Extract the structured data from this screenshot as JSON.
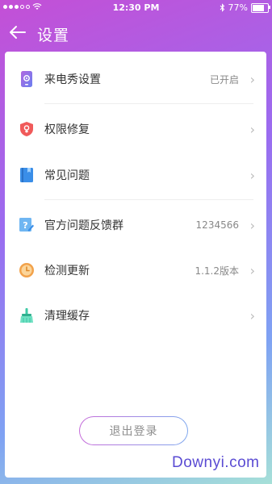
{
  "status_bar": {
    "time": "12:30 PM",
    "battery": "77%",
    "battery_level": 0.77
  },
  "header": {
    "title": "设置"
  },
  "items": [
    {
      "label": "来电秀设置",
      "value": "已开启",
      "icon": "phone-settings-icon"
    },
    {
      "label": "权限修复",
      "value": "",
      "icon": "shield-icon"
    },
    {
      "label": "常见问题",
      "value": "",
      "icon": "book-icon"
    },
    {
      "label": "官方问题反馈群",
      "value": "1234566",
      "icon": "question-icon"
    },
    {
      "label": "检测更新",
      "value": "1.1.2版本",
      "icon": "clock-icon"
    },
    {
      "label": "清理缓存",
      "value": "",
      "icon": "broom-icon"
    }
  ],
  "logout": {
    "label": "退出登录"
  },
  "watermark": "Downyi.com",
  "colors": {
    "accent_purple": "#9a6cf0",
    "shield_red": "#f05a5a",
    "book_blue": "#3a8ee8",
    "clock_orange": "#f2a24b",
    "broom_green": "#3ec9a5"
  }
}
